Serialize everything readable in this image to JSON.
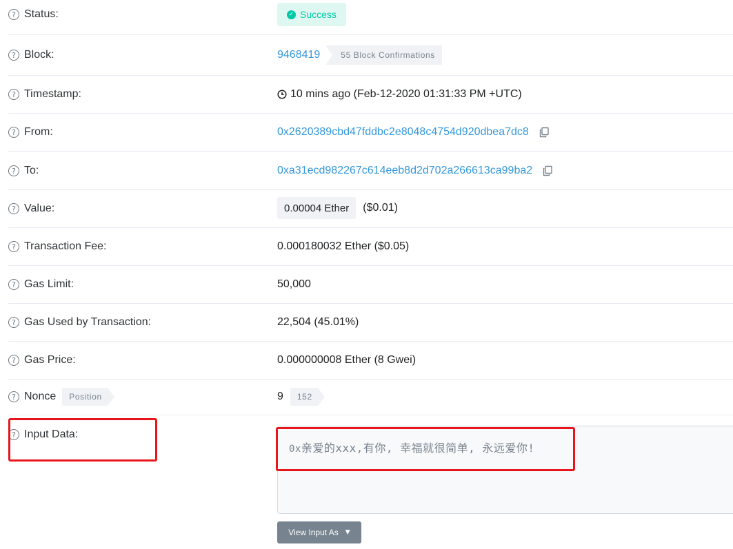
{
  "rows": {
    "status": {
      "label": "Status:",
      "badge": "Success"
    },
    "block": {
      "label": "Block:",
      "number": "9468419",
      "confirmations": "55 Block Confirmations"
    },
    "timestamp": {
      "label": "Timestamp:",
      "value": "10 mins ago (Feb-12-2020 01:31:33 PM +UTC)"
    },
    "from": {
      "label": "From:",
      "address": "0x2620389cbd47fddbc2e8048c4754d920dbea7dc8"
    },
    "to": {
      "label": "To:",
      "address": "0xa31ecd982267c614eeb8d2d702a266613ca99ba2"
    },
    "value": {
      "label": "Value:",
      "ether": "0.00004 Ether",
      "usd": "($0.01)"
    },
    "fee": {
      "label": "Transaction Fee:",
      "value": "0.000180032 Ether ($0.05)"
    },
    "gas_limit": {
      "label": "Gas Limit:",
      "value": "50,000"
    },
    "gas_used": {
      "label": "Gas Used by Transaction:",
      "value": "22,504 (45.01%)"
    },
    "gas_price": {
      "label": "Gas Price:",
      "value": "0.000000008 Ether (8 Gwei)"
    },
    "nonce": {
      "label": "Nonce",
      "tag": "Position",
      "value": "9",
      "position": "152"
    },
    "input": {
      "label": "Input Data:",
      "prefix": "0x",
      "text": "亲爱的xxx,有你, 幸福就很简单, 永远爱你!",
      "button": "View Input As"
    }
  },
  "icons": {
    "help": "question-circle-icon",
    "success": "check-circle-icon",
    "clock": "clock-icon",
    "copy": "copy-icon",
    "caret": "chevron-down-icon"
  },
  "colors": {
    "link": "#3498db",
    "success_bg": "#def8f1",
    "success_text": "#00c9a7",
    "highlight": "#e8151c"
  }
}
